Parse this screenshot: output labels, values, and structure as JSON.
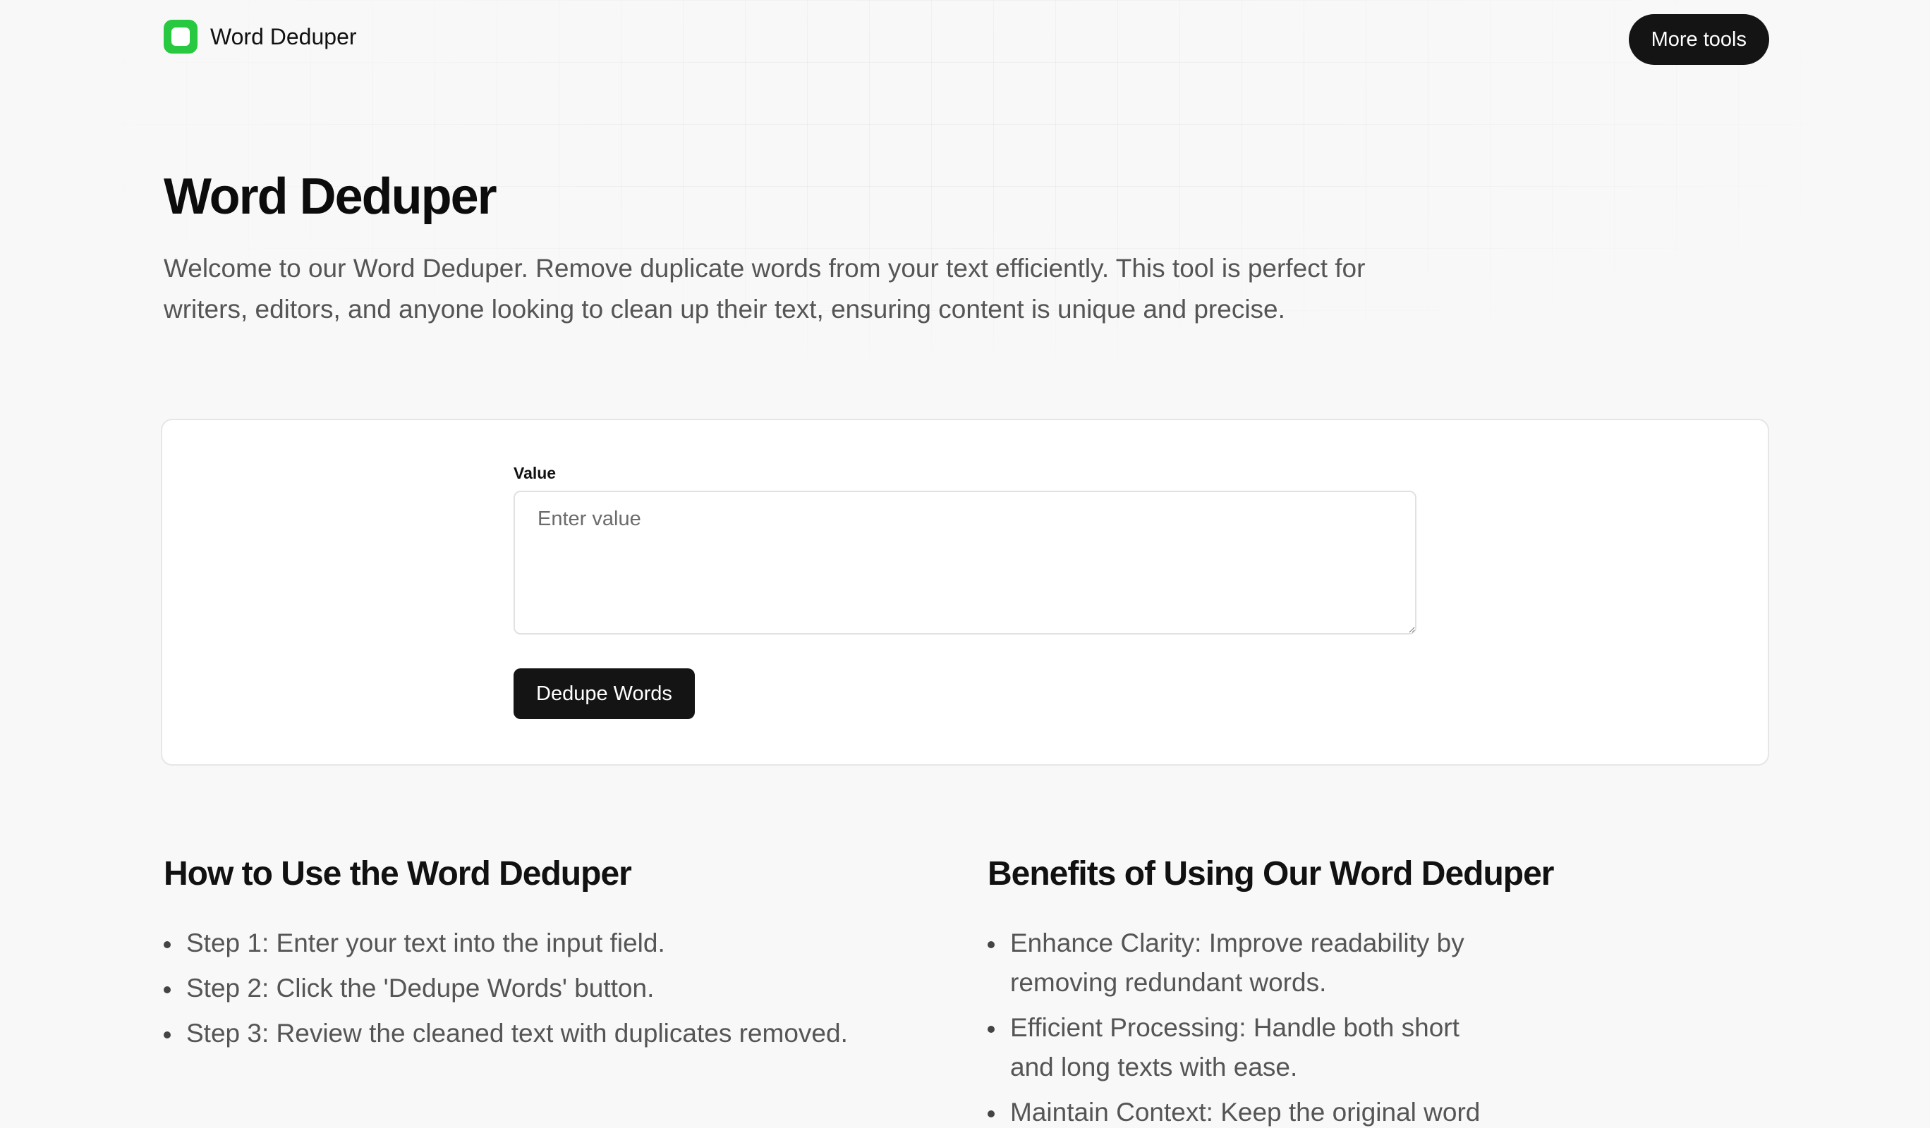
{
  "header": {
    "logo_text": "Word Deduper",
    "more_tools_label": "More tools"
  },
  "hero": {
    "title": "Word Deduper",
    "description": "Welcome to our Word Deduper. Remove duplicate words from your text efficiently. This tool is perfect for writers, editors, and anyone looking to clean up their text, ensuring content is unique and precise."
  },
  "tool": {
    "field_label": "Value",
    "placeholder": "Enter value",
    "value": "",
    "button_label": "Dedupe Words"
  },
  "how_to": {
    "title": "How to Use the Word Deduper",
    "steps": [
      "Step 1: Enter your text into the input field.",
      "Step 2: Click the 'Dedupe Words' button.",
      "Step 3: Review the cleaned text with duplicates removed."
    ]
  },
  "benefits": {
    "title": "Benefits of Using Our Word Deduper",
    "items": [
      "Enhance Clarity: Improve readability by removing redundant words.",
      "Efficient Processing: Handle both short and long texts with ease.",
      "Maintain Context: Keep the original word"
    ]
  },
  "colors": {
    "accent": "#28c840",
    "dark_button": "#141414",
    "background": "#f8f8f8"
  }
}
